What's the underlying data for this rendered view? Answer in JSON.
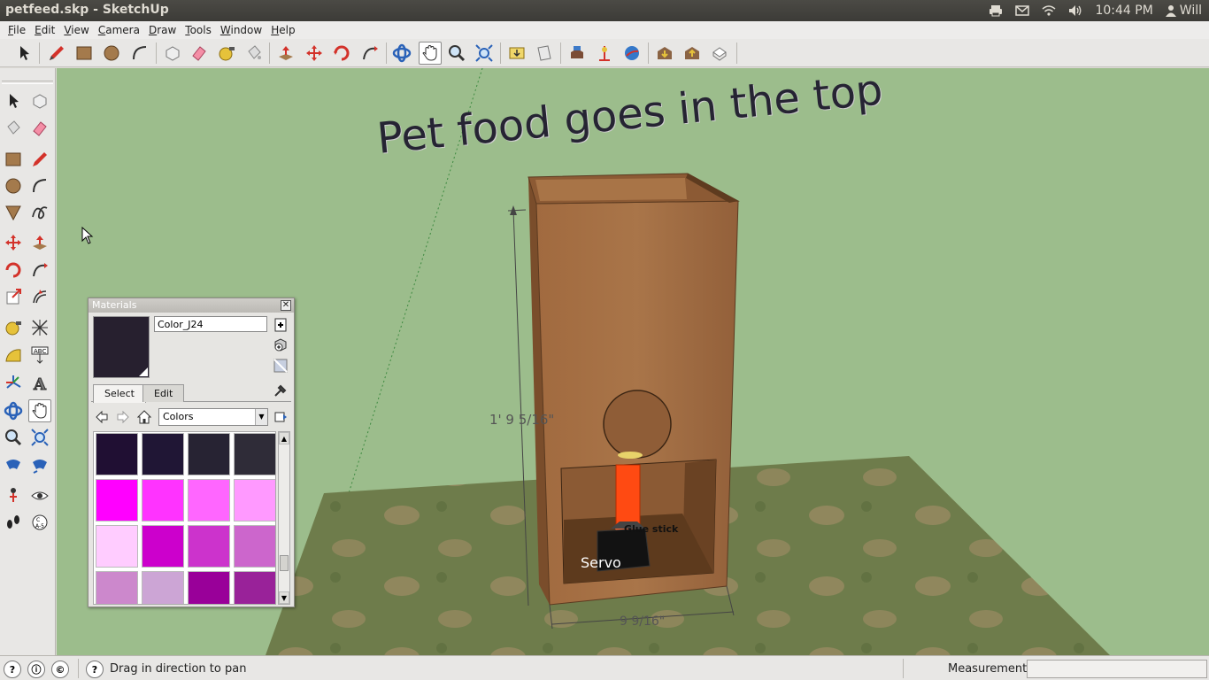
{
  "window": {
    "title": "petfeed.skp - SketchUp",
    "clock": "10:44 PM",
    "user": "Will"
  },
  "menu": {
    "items": [
      {
        "label": "File",
        "mnemonic": "F",
        "rest": "ile"
      },
      {
        "label": "Edit",
        "mnemonic": "E",
        "rest": "dit"
      },
      {
        "label": "View",
        "mnemonic": "V",
        "rest": "iew"
      },
      {
        "label": "Camera",
        "mnemonic": "C",
        "rest": "amera"
      },
      {
        "label": "Draw",
        "mnemonic": "D",
        "rest": "raw"
      },
      {
        "label": "Tools",
        "mnemonic": "T",
        "rest": "ools"
      },
      {
        "label": "Window",
        "mnemonic": "W",
        "rest": "indow"
      },
      {
        "label": "Help",
        "mnemonic": "H",
        "rest": "elp"
      }
    ]
  },
  "scene": {
    "headline": "Pet food goes in the top",
    "dim_height": "1' 9 5/16\"",
    "dim_width": "9 9/16\"",
    "label_servo": "Servo",
    "label_glue": "Glue stick",
    "colors": {
      "sky": "#9cbd8c",
      "ground": "#6f7c4a",
      "wood": "#9a6640",
      "wood_dark": "#6e4527",
      "pipe": "#ff4a12",
      "servo": "#111111"
    }
  },
  "materials": {
    "title": "Materials",
    "material_name": "Color_J24",
    "preview_color": "#27202f",
    "tabs": [
      "Select",
      "Edit"
    ],
    "active_tab": "Select",
    "collection": "Colors",
    "swatches": [
      "#200f33",
      "#201635",
      "#272333",
      "#2f2c38",
      "#ff00ff",
      "#ff33ff",
      "#ff66ff",
      "#ff99ff",
      "#ffccff",
      "#cc00cc",
      "#cc33cc",
      "#cc66cc",
      "#cc88cc",
      "#cca5d5",
      "#990099",
      "#992299"
    ]
  },
  "status": {
    "hint": "Drag in direction to pan",
    "measurements_label": "Measurements",
    "measurements_value": ""
  }
}
